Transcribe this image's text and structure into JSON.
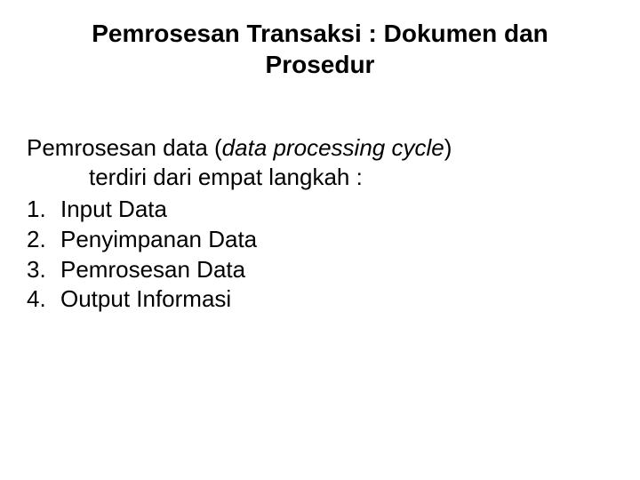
{
  "title": "Pemrosesan Transaksi : Dokumen dan Prosedur",
  "intro": {
    "prefix": "Pemrosesan data (",
    "italic": "data processing cycle",
    "suffix": ")",
    "line2": "terdiri dari empat langkah :"
  },
  "items": [
    {
      "num": "1.",
      "text": "Input Data"
    },
    {
      "num": "2.",
      "text": "Penyimpanan Data"
    },
    {
      "num": "3.",
      "text": "Pemrosesan Data"
    },
    {
      "num": "4.",
      "text": "Output Informasi"
    }
  ]
}
